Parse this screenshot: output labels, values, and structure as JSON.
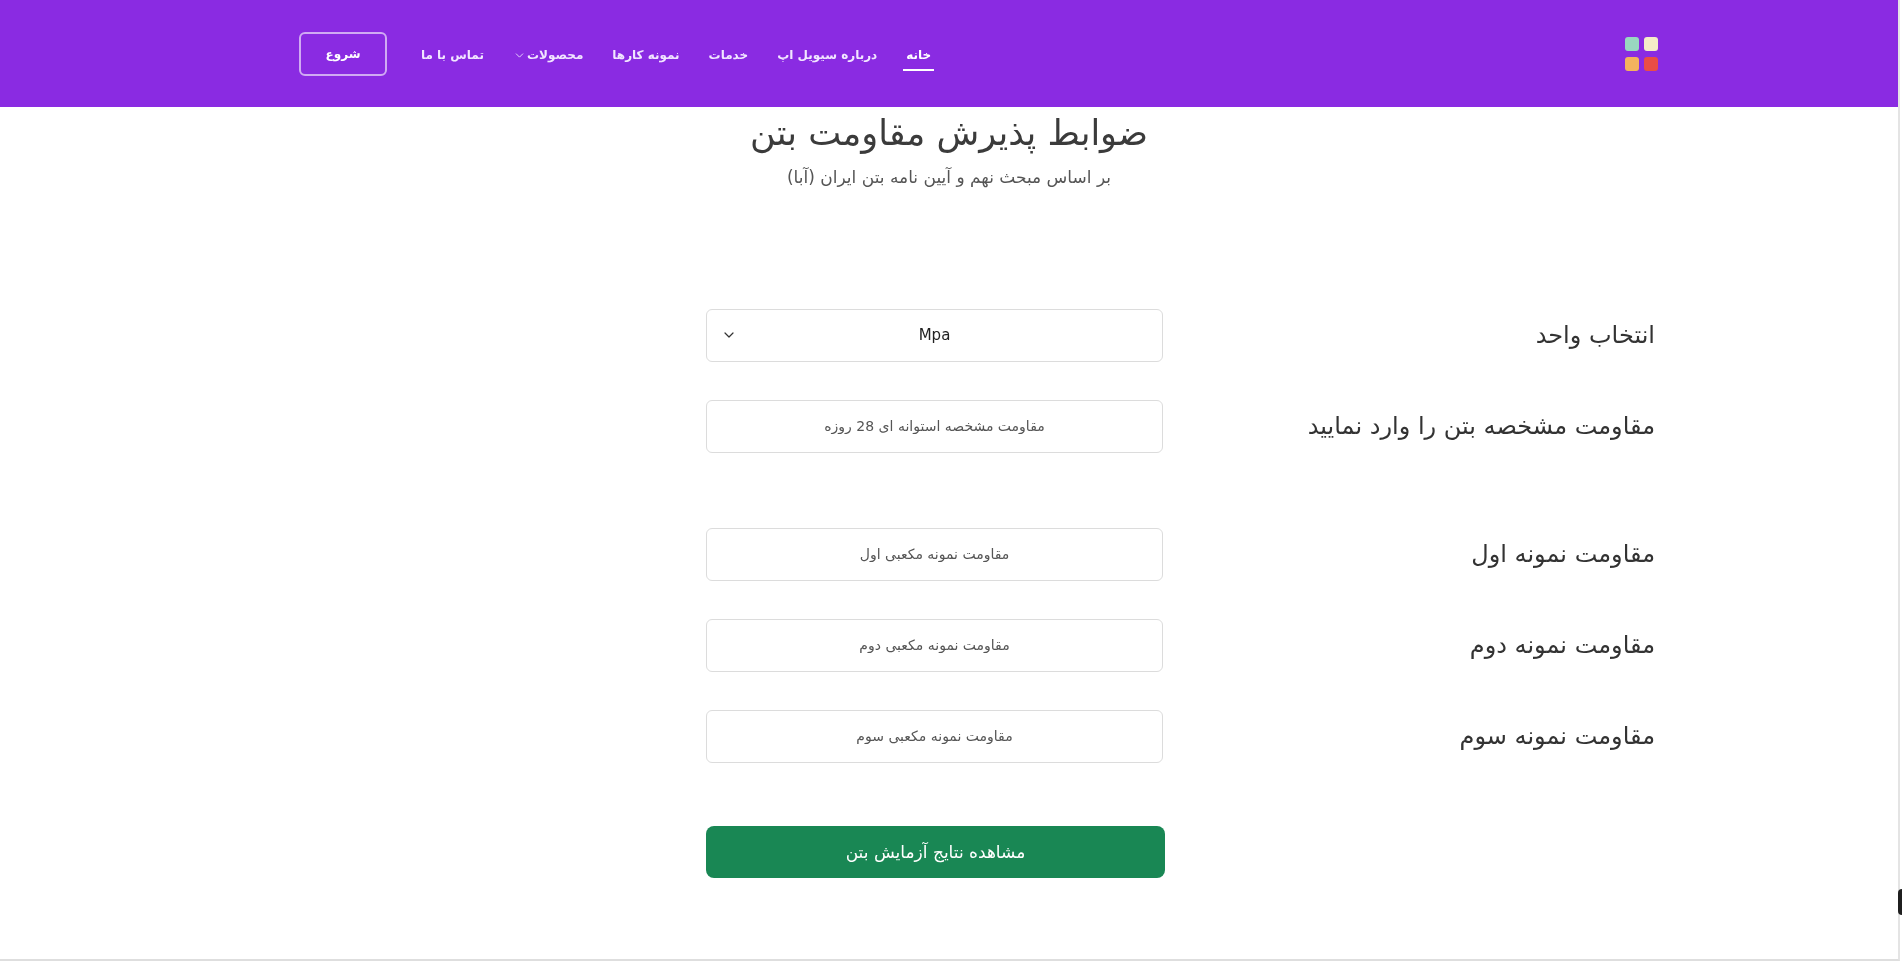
{
  "header": {
    "nav": [
      {
        "label": "خانه",
        "selected": true,
        "kind": "link"
      },
      {
        "label": "درباره سیویل اپ",
        "selected": false,
        "kind": "link"
      },
      {
        "label": "خدمات",
        "selected": false,
        "kind": "link"
      },
      {
        "label": "نمونه کارها",
        "selected": false,
        "kind": "link"
      },
      {
        "label": "محصولات",
        "selected": false,
        "kind": "dropdown"
      },
      {
        "label": "تماس با ما",
        "selected": false,
        "kind": "link"
      }
    ],
    "start_button": "شروع"
  },
  "heading": {
    "title": "ضوابط پذیرش مقاومت بتن",
    "subtitle": "بر اساس مبحث نهم و آیین نامه بتن ایران (آبا)"
  },
  "form": {
    "sections": [
      {
        "rows": [
          {
            "kind": "select",
            "label": "انتخاب واحد",
            "value": "Mpa"
          },
          {
            "kind": "input",
            "label": "مقاومت مشخصه بتن را وارد نمایید",
            "placeholder": "مقاومت مشخصه استوانه ای 28 روزه"
          }
        ]
      },
      {
        "rows": [
          {
            "kind": "input",
            "label": "مقاومت نمونه اول",
            "placeholder": "مقاومت نمونه مکعبی اول"
          },
          {
            "kind": "input",
            "label": "مقاومت نمونه دوم",
            "placeholder": "مقاومت نمونه مکعبی دوم"
          },
          {
            "kind": "input",
            "label": "مقاومت نمونه سوم",
            "placeholder": "مقاومت نمونه مکعبی سوم"
          }
        ]
      }
    ],
    "submit": "مشاهده نتایج آزمایش بتن"
  }
}
